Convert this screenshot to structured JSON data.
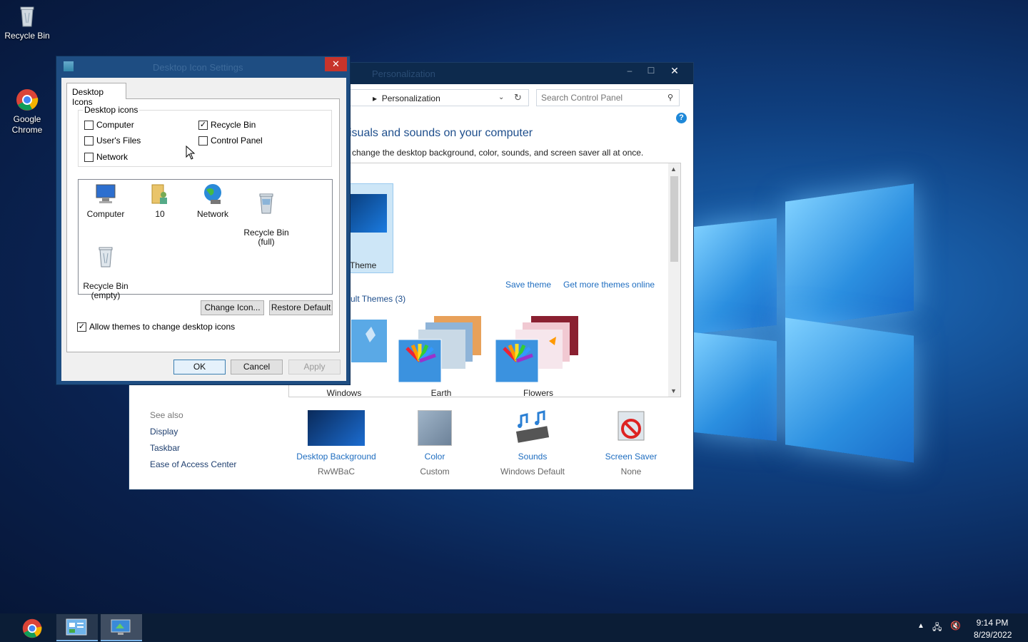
{
  "desktop": {
    "icons": [
      {
        "label": "Recycle Bin",
        "icon": "recycle-bin-icon"
      },
      {
        "label": "Google\nChrome",
        "icon": "chrome-icon"
      }
    ]
  },
  "personalization": {
    "title": "Personalization",
    "breadcrumb": "Personalization",
    "search_placeholder": "Search Control Panel",
    "heading": "visuals and sounds on your computer",
    "subheading": "change the desktop background, color, sounds, and screen saver all at once.",
    "my_theme_label": "Theme",
    "save_theme": "Save theme",
    "get_more_themes": "Get more themes online",
    "default_themes_header": "ult Themes (3)",
    "themes": [
      {
        "label": "Windows"
      },
      {
        "label": "Earth"
      },
      {
        "label": "Flowers"
      }
    ],
    "see_also": "See also",
    "side_links": [
      "Display",
      "Taskbar",
      "Ease of Access Center"
    ],
    "bottom": [
      {
        "title": "Desktop Background",
        "value": "RwWBaC"
      },
      {
        "title": "Color",
        "value": "Custom"
      },
      {
        "title": "Sounds",
        "value": "Windows Default"
      },
      {
        "title": "Screen Saver",
        "value": "None"
      }
    ]
  },
  "dialog": {
    "title": "Desktop Icon Settings",
    "tab": "Desktop Icons",
    "group_label": "Desktop icons",
    "checkboxes": [
      {
        "label": "Computer",
        "checked": false
      },
      {
        "label": "Recycle Bin",
        "checked": true
      },
      {
        "label": "User's Files",
        "checked": false
      },
      {
        "label": "Control Panel",
        "checked": false
      },
      {
        "label": "Network",
        "checked": false
      }
    ],
    "icon_items": [
      {
        "label": "Computer"
      },
      {
        "label": "10"
      },
      {
        "label": "Network"
      },
      {
        "label": "Recycle Bin\n(full)"
      },
      {
        "label": "Recycle Bin\n(empty)"
      }
    ],
    "change_icon": "Change Icon...",
    "restore_default": "Restore Default",
    "allow_themes": "Allow themes to change desktop icons",
    "allow_themes_checked": true,
    "ok": "OK",
    "cancel": "Cancel",
    "apply": "Apply"
  },
  "taskbar": {
    "time": "9:14 PM",
    "date": "8/29/2022"
  }
}
